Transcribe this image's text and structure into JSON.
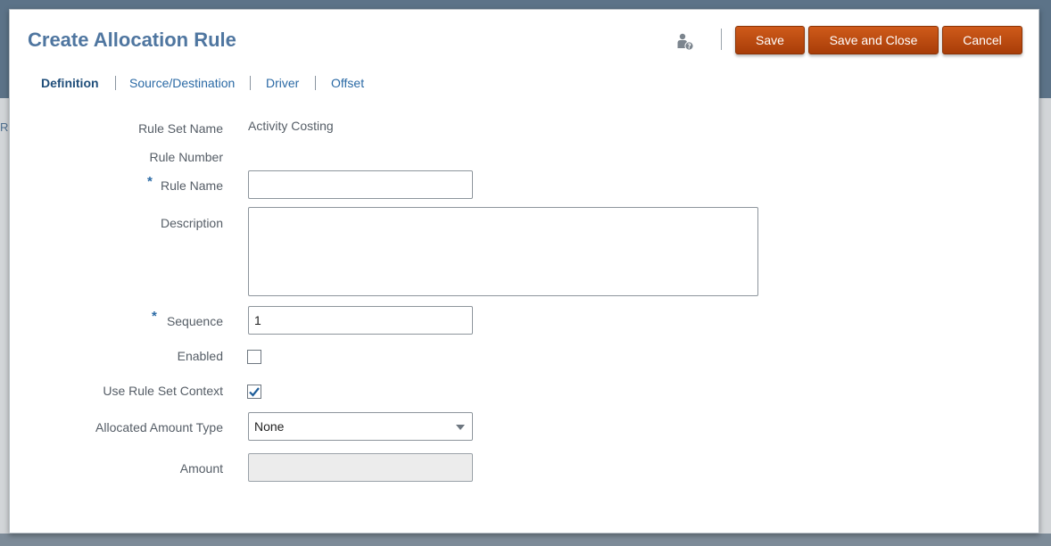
{
  "background": {
    "partial_letter": "R"
  },
  "dialog": {
    "title": "Create Allocation Rule",
    "help_icon": "user-help-icon",
    "buttons": {
      "save": "Save",
      "save_and_close": "Save and Close",
      "cancel": "Cancel"
    },
    "accent_color": "#b94a10"
  },
  "tabs": [
    {
      "label": "Definition",
      "active": true
    },
    {
      "label": "Source/Destination",
      "active": false
    },
    {
      "label": "Driver",
      "active": false
    },
    {
      "label": "Offset",
      "active": false
    }
  ],
  "form": {
    "rule_set_name": {
      "label": "Rule Set Name",
      "value": "Activity Costing"
    },
    "rule_number": {
      "label": "Rule Number",
      "value": ""
    },
    "rule_name": {
      "label": "Rule Name",
      "required_marker": "*",
      "value": ""
    },
    "description": {
      "label": "Description",
      "value": ""
    },
    "sequence": {
      "label": "Sequence",
      "required_marker": "*",
      "value": "1"
    },
    "enabled": {
      "label": "Enabled",
      "checked": false
    },
    "use_rule_set_context": {
      "label": "Use Rule Set Context",
      "checked": true
    },
    "allocated_amount_type": {
      "label": "Allocated Amount Type",
      "selected": "None"
    },
    "amount": {
      "label": "Amount",
      "value": ""
    }
  }
}
